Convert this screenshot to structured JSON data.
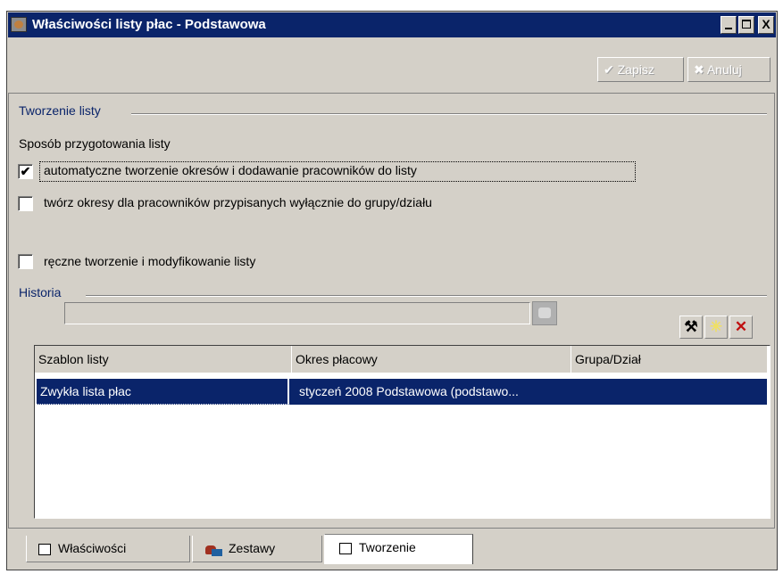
{
  "window": {
    "title": "Właściwości listy płac - Podstawowa",
    "controls": {
      "minimize": "_",
      "maximize": "□",
      "close": "X"
    }
  },
  "toolbar": {
    "save_label": "✔ Zapisz",
    "cancel_label": "✖ Anuluj"
  },
  "creation": {
    "section_title": "Tworzenie listy",
    "method_label": "Sposób przygotowania listy",
    "options": [
      {
        "label": "automatyczne tworzenie okresów i dodawanie pracowników do listy",
        "checked": true,
        "check_mark": "✔"
      },
      {
        "label": "twórz okresy dla pracowników przypisanych wyłącznie do grupy/działu",
        "checked": false
      },
      {
        "label": "ręczne tworzenie i modyfikowanie listy",
        "checked": false
      }
    ],
    "group_value": ""
  },
  "history": {
    "section_title": "Historia",
    "buttons": [
      {
        "icon": "tools-icon",
        "glyph": "⚒"
      },
      {
        "icon": "new-icon",
        "glyph": "✳"
      },
      {
        "icon": "delete-icon",
        "glyph": "✕"
      }
    ],
    "columns": [
      "Szablon listy",
      "Okres płacowy",
      "Grupa/Dział"
    ],
    "rows": [
      {
        "template": "Zwykła lista płac",
        "period": "styczeń 2008 Podstawowa (podstawo...",
        "group": ""
      }
    ]
  },
  "tabs": [
    {
      "label": "Właściwości",
      "active": false
    },
    {
      "label": "Zestawy",
      "active": false
    },
    {
      "label": "Tworzenie",
      "active": true
    }
  ],
  "colors": {
    "title_bar": "#0a246a",
    "selection": "#0a246a",
    "face": "#d4d0c8",
    "section_text": "#0a246a"
  }
}
